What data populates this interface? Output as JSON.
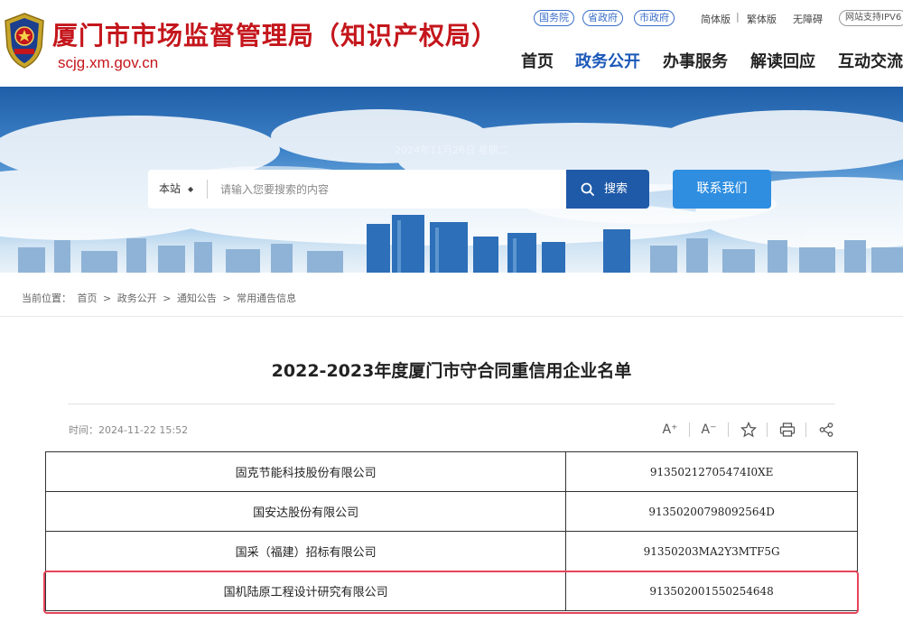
{
  "header": {
    "title": "厦门市市场监督管理局（知识产权局）",
    "domain": "scjg.xm.gov.cn",
    "top_links": [
      "国务院",
      "省政府",
      "市政府"
    ],
    "lang_simplified": "简体版",
    "lang_traditional": "繁体版",
    "accessibility": "无障碍",
    "ipv6": "网站支持IPV6",
    "nav": [
      "首页",
      "政务公开",
      "办事服务",
      "解读回应",
      "互动交流"
    ],
    "active_nav": "政务公开",
    "title_color": "#c4161c",
    "nav_active_color": "#1a57b8"
  },
  "banner": {
    "date": "2024年11月26日 星期二",
    "scope": "本站",
    "search_placeholder": "请输入您要搜索的内容",
    "search_label": "搜索",
    "contact_label": "联系我们"
  },
  "breadcrumb": {
    "prefix": "当前位置：",
    "items": [
      "首页",
      "政务公开",
      "通知公告",
      "常用通告信息"
    ],
    "separator": ">"
  },
  "article": {
    "title": "2022-2023年度厦门市守合同重信用企业名单",
    "time": "时间：2024-11-22 15:52",
    "tools": [
      "font-increase-icon",
      "font-decrease-icon",
      "star-icon",
      "print-icon",
      "share-icon"
    ],
    "font_increase_glyph": "A⁺",
    "font_decrease_glyph": "A⁻",
    "rows": [
      {
        "name": "固克节能科技股份有限公司",
        "code": "91350212705474I0XE"
      },
      {
        "name": "国安达股份有限公司",
        "code": "91350200798092564D"
      },
      {
        "name": "国采（福建）招标有限公司",
        "code": "91350203MA2Y3MTF5G"
      },
      {
        "name": "国机陆原工程设计研究有限公司",
        "code": "913502001550254648"
      }
    ],
    "highlight_color": "#e5455a"
  }
}
